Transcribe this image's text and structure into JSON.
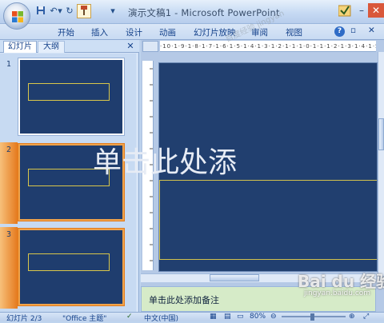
{
  "window": {
    "title": "演示文稿1 - Microsoft PowerPoint",
    "controls": {
      "minimize": "–",
      "close": "✕"
    }
  },
  "quick_access": {
    "save_icon": "save-icon",
    "undo_label": "↶",
    "dropdown_label": "▾",
    "redo_label": "↻",
    "customize_label": "▾"
  },
  "ribbon": {
    "tabs": [
      "开始",
      "插入",
      "设计",
      "动画",
      "幻灯片放映",
      "审阅",
      "视图"
    ],
    "help_label": "?",
    "restore_label": "▫",
    "close_label": "✕"
  },
  "left_pane": {
    "tabs": [
      "幻灯片",
      "大纲"
    ],
    "close_label": "✕",
    "thumbnails": [
      {
        "number": "1",
        "selected": false
      },
      {
        "number": "2",
        "selected": true
      },
      {
        "number": "3",
        "selected": true
      }
    ]
  },
  "ruler": {
    "ticks": "·10·1·9·1·8·1·7·1·6·1·5·1·4·1·3·1·2·1·1·1·0·1·1·1·2·1·3·1·4·1·5·1·6·1·7"
  },
  "slide": {
    "title_placeholder": "单击此处添"
  },
  "notes": {
    "placeholder": "单击此处添加备注"
  },
  "status": {
    "slide_count": "幻灯片 2/3",
    "theme": "\"Office 主题\"",
    "language": "中文(中国)",
    "zoom": "80%"
  },
  "watermarks": {
    "top": "百度经验 jingyan",
    "logo": "Bai du 经验",
    "url": "jingyan.baidu.com"
  },
  "colors": {
    "slide_bg": "#213f6f",
    "placeholder_border": "#d2c14d",
    "selection": "#f0a24a"
  }
}
